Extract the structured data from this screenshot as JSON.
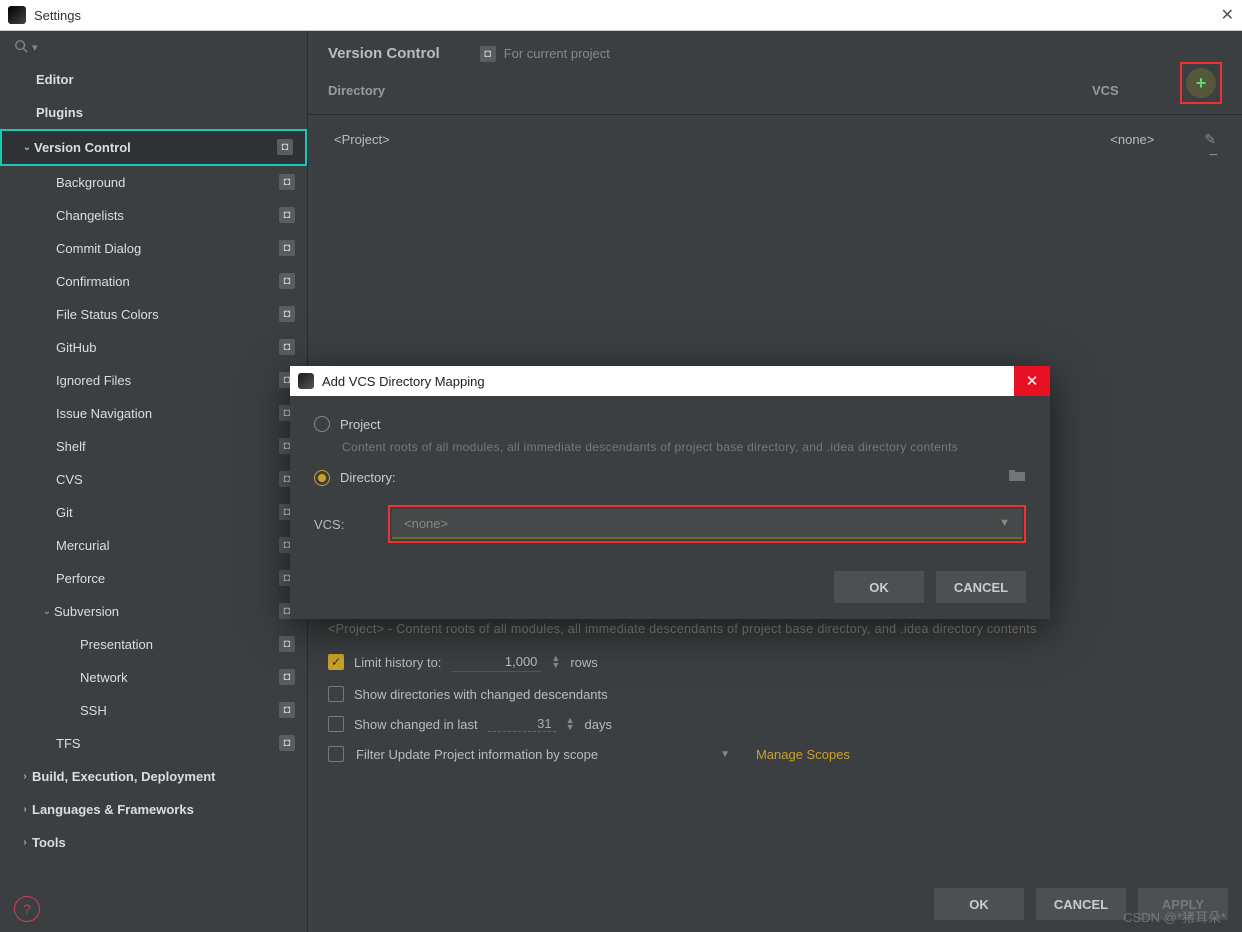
{
  "window": {
    "title": "Settings"
  },
  "sidebar": {
    "items": [
      {
        "label": "Editor",
        "level": "lv0",
        "hasPer": false
      },
      {
        "label": "Plugins",
        "level": "lv0",
        "hasPer": false
      },
      {
        "label": "Version Control",
        "level": "lv0c",
        "hasPer": true,
        "chev": "⌄",
        "highlighted": true,
        "selected": true
      },
      {
        "label": "Background",
        "level": "lv1",
        "hasPer": true
      },
      {
        "label": "Changelists",
        "level": "lv1",
        "hasPer": true
      },
      {
        "label": "Commit Dialog",
        "level": "lv1",
        "hasPer": true
      },
      {
        "label": "Confirmation",
        "level": "lv1",
        "hasPer": true
      },
      {
        "label": "File Status Colors",
        "level": "lv1",
        "hasPer": true
      },
      {
        "label": "GitHub",
        "level": "lv1",
        "hasPer": true
      },
      {
        "label": "Ignored Files",
        "level": "lv1",
        "hasPer": true
      },
      {
        "label": "Issue Navigation",
        "level": "lv1",
        "hasPer": true
      },
      {
        "label": "Shelf",
        "level": "lv1",
        "hasPer": true
      },
      {
        "label": "CVS",
        "level": "lv1",
        "hasPer": true
      },
      {
        "label": "Git",
        "level": "lv1",
        "hasPer": true
      },
      {
        "label": "Mercurial",
        "level": "lv1",
        "hasPer": true
      },
      {
        "label": "Perforce",
        "level": "lv1",
        "hasPer": true
      },
      {
        "label": "Subversion",
        "level": "lv1c",
        "hasPer": true,
        "chev": "⌄"
      },
      {
        "label": "Presentation",
        "level": "lv2",
        "hasPer": true
      },
      {
        "label": "Network",
        "level": "lv2",
        "hasPer": true
      },
      {
        "label": "SSH",
        "level": "lv2",
        "hasPer": true
      },
      {
        "label": "TFS",
        "level": "lv1",
        "hasPer": true
      },
      {
        "label": "Build, Execution, Deployment",
        "level": "lv0c",
        "hasPer": false,
        "chev": "›"
      },
      {
        "label": "Languages & Frameworks",
        "level": "lv0c",
        "hasPer": false,
        "chev": "›"
      },
      {
        "label": "Tools",
        "level": "lv0c",
        "hasPer": false,
        "chev": "›"
      }
    ]
  },
  "header": {
    "title": "Version Control",
    "for_project": "For current project"
  },
  "table": {
    "col_dir": "Directory",
    "col_vcs": "VCS",
    "row": {
      "dir": "<Project>",
      "vcs": "<none>"
    }
  },
  "info": {
    "desc": "<Project> - Content roots of all modules, all immediate descendants of project base directory, and .idea directory contents",
    "limit_label": "Limit history to:",
    "limit_value": "1,000",
    "limit_unit": "rows",
    "show_desc": "Show directories with changed descendants",
    "show_changed": "Show changed in last",
    "show_changed_val": "31",
    "show_changed_unit": "days",
    "filter_label": "Filter Update Project information by scope",
    "manage": "Manage Scopes"
  },
  "footer": {
    "ok": "OK",
    "cancel": "CANCEL",
    "apply": "APPLY"
  },
  "modal": {
    "title": "Add VCS Directory Mapping",
    "project": "Project",
    "proj_desc": "Content roots of all modules, all immediate descendants of project base directory, and .idea directory contents",
    "directory": "Directory:",
    "vcs_label": "VCS:",
    "vcs_value": "<none>",
    "ok": "OK",
    "cancel": "CANCEL"
  },
  "watermark": "CSDN @*猪耳朵*"
}
